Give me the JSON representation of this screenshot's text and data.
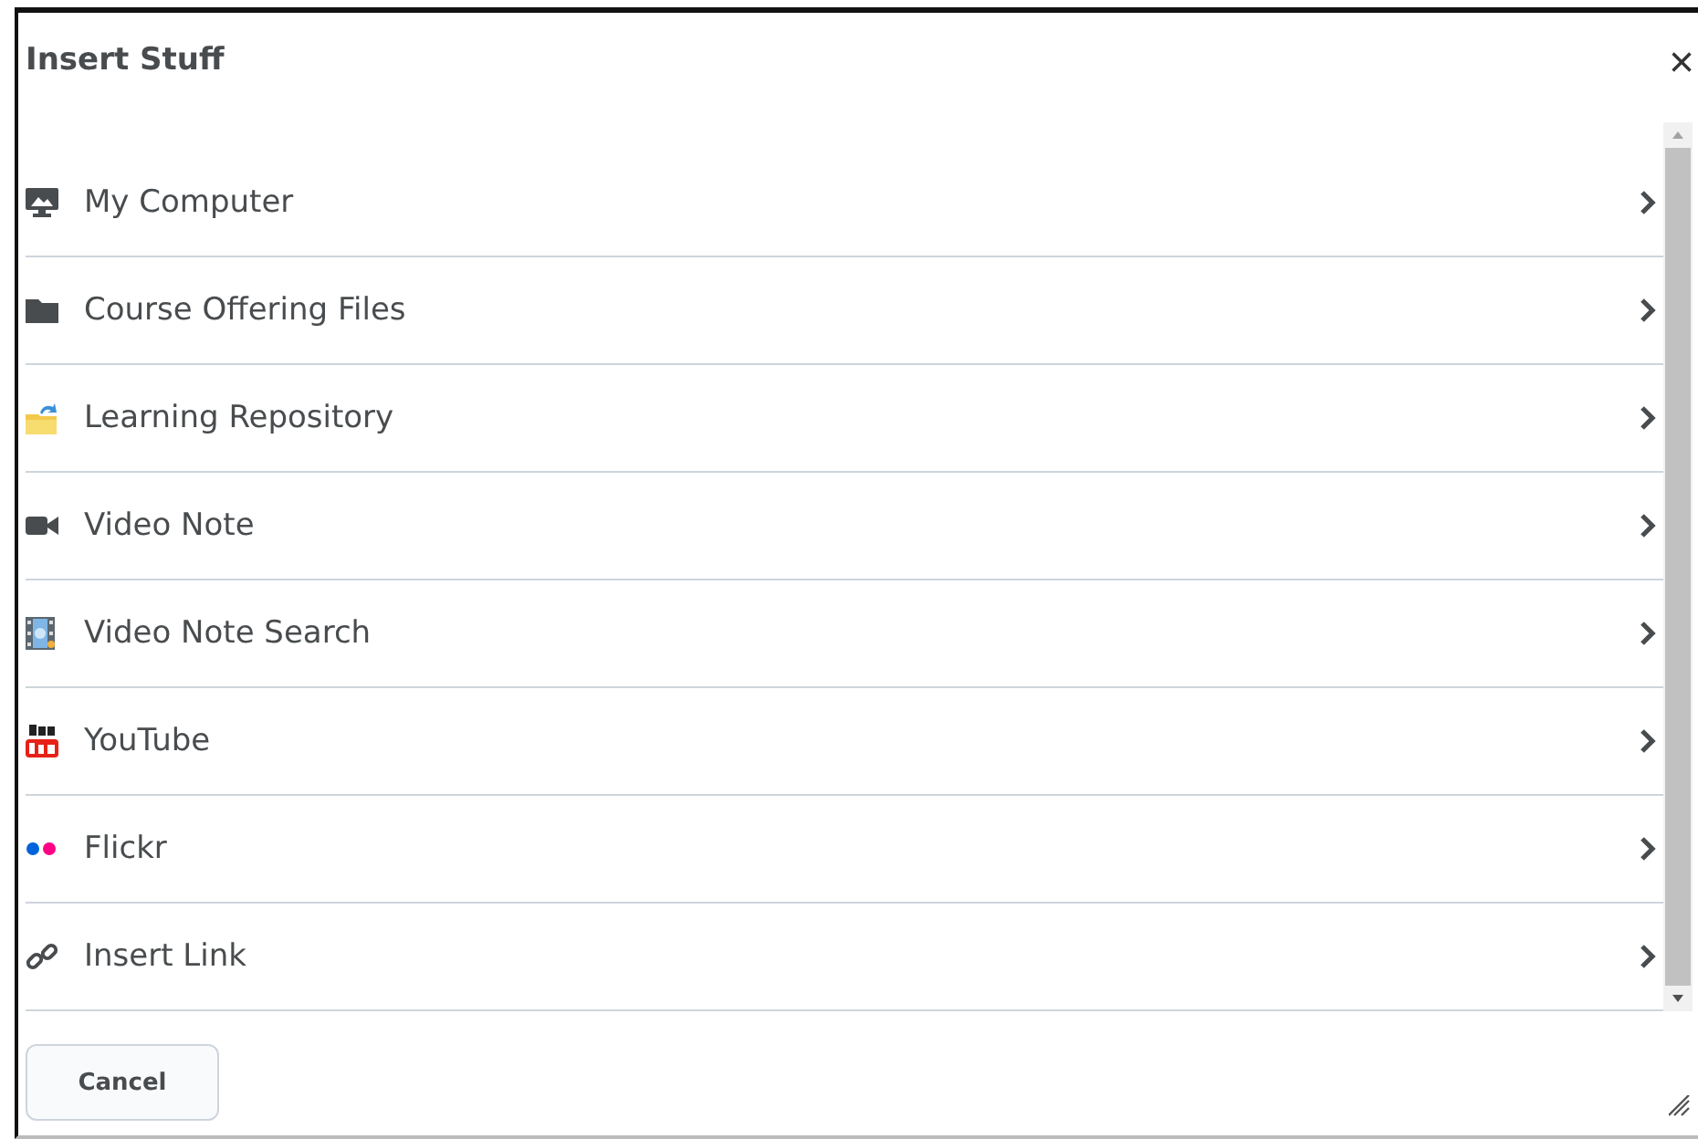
{
  "dialog": {
    "title": "Insert Stuff",
    "close": "×"
  },
  "items": [
    {
      "kind": "computer",
      "label": "My Computer"
    },
    {
      "kind": "folder",
      "label": "Course Offering Files"
    },
    {
      "kind": "repository",
      "label": "Learning Repository"
    },
    {
      "kind": "camera",
      "label": "Video Note"
    },
    {
      "kind": "film",
      "label": "Video Note Search"
    },
    {
      "kind": "youtube",
      "label": "YouTube"
    },
    {
      "kind": "flickr",
      "label": "Flickr"
    },
    {
      "kind": "link",
      "label": "Insert Link"
    }
  ],
  "buttons": [
    "Cancel"
  ]
}
